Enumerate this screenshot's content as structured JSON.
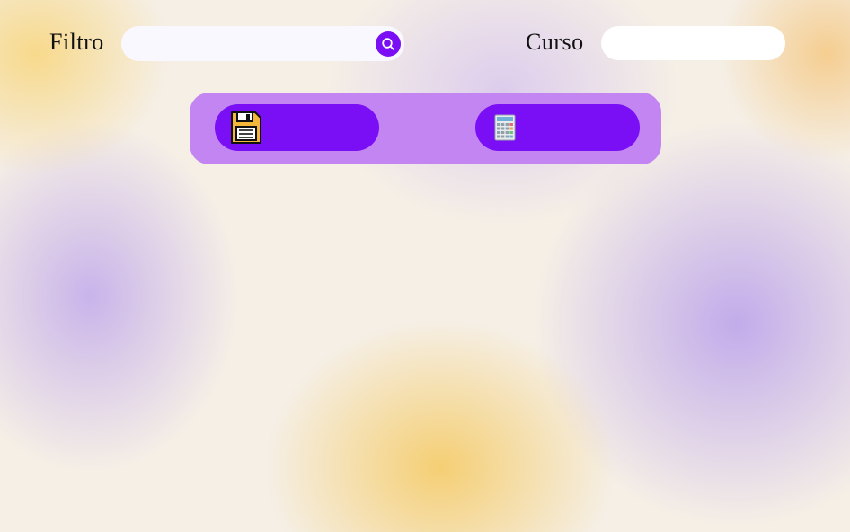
{
  "filter": {
    "label": "Filtro",
    "value": "",
    "placeholder": ""
  },
  "course": {
    "label": "Curso",
    "value": "",
    "placeholder": ""
  },
  "toolbar": {
    "save_label": "",
    "calculator_label": ""
  },
  "icons": {
    "search": "search-icon",
    "save": "floppy-disk-icon",
    "calculator": "calculator-icon"
  },
  "colors": {
    "accent": "#7a0ef5",
    "toolbar_background": "#c285f2",
    "save_icon_fill": "#f5b73a"
  }
}
